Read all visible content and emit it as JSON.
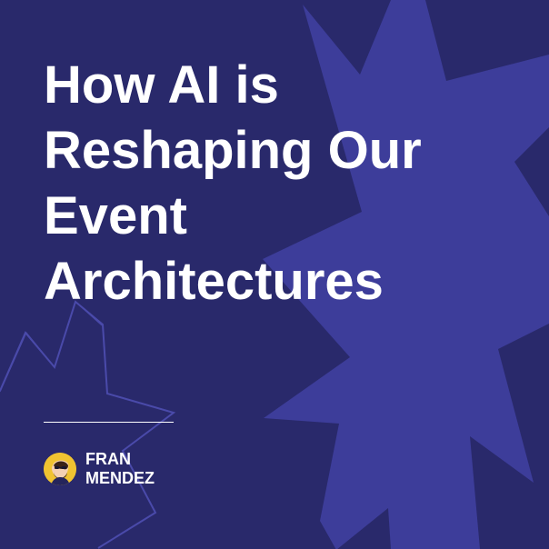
{
  "title_lines": [
    "How AI is",
    "Reshaping Our",
    "Event",
    "Architectures"
  ],
  "author": {
    "first_name": "FRAN",
    "last_name": "MENDEZ"
  },
  "colors": {
    "background": "#29296b",
    "starburst": "#3d3d9a",
    "outline": "#4a4aaa",
    "text": "#ffffff",
    "avatar": "#f0c331"
  },
  "icons": {
    "avatar": "person-avatar-icon",
    "background": "starburst-shape"
  }
}
